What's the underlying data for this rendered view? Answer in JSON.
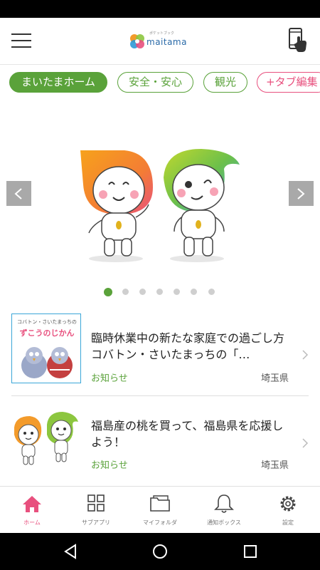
{
  "header": {
    "logo_small": "ポケットブック",
    "logo_text": "maitama"
  },
  "tabs": [
    {
      "label": "まいたまホーム"
    },
    {
      "label": "安全・安心"
    },
    {
      "label": "観光"
    },
    {
      "label": "+タブ編集"
    }
  ],
  "carousel": {
    "dot_count": 7,
    "active_index": 0
  },
  "news": [
    {
      "thumb_text_top": "コバトン・さいたまっちの",
      "thumb_text_main": "ずこうのじかん",
      "title": "臨時休業中の新たな家庭での過ごし方コバトン・さいたまっちの「…",
      "category": "お知らせ",
      "source": "埼玉県"
    },
    {
      "title": "福島産の桃を買って、福島県を応援しよう！",
      "category": "お知らせ",
      "source": "埼玉県"
    }
  ],
  "bottom_nav": [
    {
      "label": "ホーム",
      "icon": "home-icon"
    },
    {
      "label": "サブアプリ",
      "icon": "grid-icon"
    },
    {
      "label": "マイフォルダ",
      "icon": "folder-icon"
    },
    {
      "label": "通知ボックス",
      "icon": "bell-icon"
    },
    {
      "label": "設定",
      "icon": "gear-icon"
    }
  ],
  "colors": {
    "accent_green": "#5aa23a",
    "accent_pink": "#e8507e"
  }
}
